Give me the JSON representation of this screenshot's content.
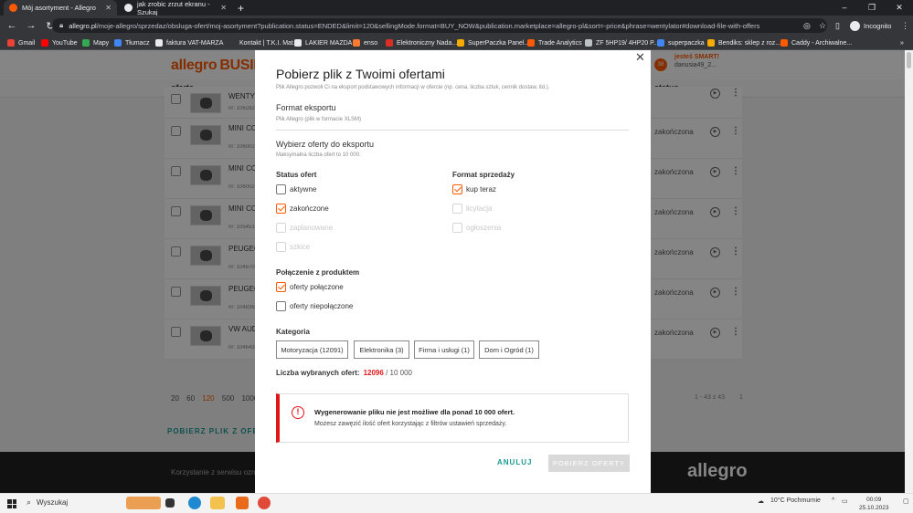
{
  "browser": {
    "tabs": [
      {
        "title": "Mój asortyment - Allegro",
        "active": true,
        "color": "#ff5a00"
      },
      {
        "title": "jak zrobic zrzut ekranu - Szukaj",
        "active": false,
        "color": "#4285f4"
      }
    ],
    "url_host": "allegro.pl",
    "url_path": "/moje-allegro/sprzedaz/obsluga-ofert/moj-asortyment?publication.status=ENDED&limit=120&sellingMode.format=BUY_NOW&publication.marketplace=allegro-pl&sort=-price&phrase=wentylator#download-file-with-offers",
    "incognito_label": "Incognito",
    "bookmarks": [
      {
        "label": "Gmail",
        "color": "#ea4335"
      },
      {
        "label": "YouTube",
        "color": "#ff0000"
      },
      {
        "label": "Mapy",
        "color": "#34a853"
      },
      {
        "label": "Tłumacz",
        "color": "#4285f4"
      },
      {
        "label": "faktura VAT-MARZA",
        "color": "#e8eaed"
      },
      {
        "label": "Kontakt | T.K.I. Mat...",
        "color": "#35363a"
      },
      {
        "label": "LAKIER MAZDA",
        "color": "#e8eaed"
      },
      {
        "label": "enso",
        "color": "#ff7a2f"
      },
      {
        "label": "Elektroniczny Nada...",
        "color": "#d93025"
      },
      {
        "label": "SuperPaczka Panel...",
        "color": "#f9ab00"
      },
      {
        "label": "Trade Analytics",
        "color": "#ff5a00"
      },
      {
        "label": "ZF 5HP19/ 4HP20 P...",
        "color": "#bdc1c6"
      },
      {
        "label": "superpaczka",
        "color": "#4285f4"
      },
      {
        "label": "Bendiks: sklep z roz...",
        "color": "#f9ab00"
      },
      {
        "label": "Caddy - Archiwalne...",
        "color": "#ff5a00"
      }
    ]
  },
  "page": {
    "logo": "allegro",
    "logo_suffix": "BUSIN",
    "account_line1": "jesteś SMART!",
    "account_line2": "danusia49_2...",
    "cart_count": "38",
    "col_oferta": "oferta",
    "col_status": "status",
    "rows": [
      {
        "title": "WENTYL",
        "nr": "nr: 106282",
        "status": ""
      },
      {
        "title": "MINI CO DMUCHA",
        "nr": "nr: 106002",
        "status": "zakończona"
      },
      {
        "title": "MINI CO DMUCHA",
        "nr": "nr: 106002",
        "status": "zakończona"
      },
      {
        "title": "MINI CO DMUCHA",
        "nr": "nr: 105451",
        "status": "zakończona"
      },
      {
        "title": "PEUGEO WENTYL",
        "nr": "nr: 104870",
        "status": "zakończona"
      },
      {
        "title": "PEUGEO WENTYL",
        "nr": "nr: 104836",
        "status": "zakończona"
      },
      {
        "title": "VW AUD WENTYL",
        "nr": "nr: 104643",
        "status": "zakończona"
      }
    ],
    "pager": [
      "20",
      "60",
      "120",
      "500",
      "1000"
    ],
    "pager_selected": "120",
    "pager_info": "1 - 43 z 43",
    "pager_page": "1",
    "download_link": "POBIERZ PLIK Z OFERT",
    "footer_text": "Korzystanie z serwisu ozna",
    "footer_logo": "allegro"
  },
  "modal": {
    "title": "Pobierz plik z Twoimi ofertami",
    "subtitle": "Plik Allegro pozwoli Ci na eksport podstawowych informacji w ofercie (np. cena, liczba sztuk, cennik dostaw, itd.).",
    "format_title": "Format eksportu",
    "format_sub": "Plik Allegro (plik w formacie XLSM)",
    "select_title": "Wybierz oferty do eksportu",
    "select_sub": "Maksymalna liczba ofert to 10 000.",
    "status_title": "Status ofert",
    "status_options": [
      {
        "label": "aktywne",
        "checked": false,
        "disabled": false
      },
      {
        "label": "zakończone",
        "checked": true,
        "disabled": false
      },
      {
        "label": "zaplanowane",
        "checked": false,
        "disabled": true
      },
      {
        "label": "szkice",
        "checked": false,
        "disabled": true
      }
    ],
    "format_sale_title": "Format sprzedaży",
    "format_sale_options": [
      {
        "label": "kup teraz",
        "checked": true,
        "disabled": false
      },
      {
        "label": "licytacja",
        "checked": false,
        "disabled": true
      },
      {
        "label": "ogłoszenia",
        "checked": false,
        "disabled": true
      }
    ],
    "link_title": "Połączenie z produktem",
    "link_options": [
      {
        "label": "oferty połączone",
        "checked": true,
        "disabled": false
      },
      {
        "label": "oferty niepołączone",
        "checked": false,
        "disabled": false
      }
    ],
    "category_title": "Kategoria",
    "categories": [
      "Motoryzacja (12091)",
      "Elektronika (3)",
      "Firma i usługi (1)",
      "Dom i Ogród (1)"
    ],
    "count_label": "Liczba wybranych ofert:",
    "count_value": "12096",
    "count_total": "/ 10 000",
    "alert_title": "Wygenerowanie pliku nie jest możliwe dla ponad 10 000 ofert.",
    "alert_desc": "Możesz zawęzić ilość ofert korzystając z filtrów ustawień sprzedaży.",
    "cancel_label": "ANULUJ",
    "download_label": "POBIERZ OFERTY"
  },
  "taskbar": {
    "search_label": "Wyszukaj",
    "weather": "10°C  Pochmurnie",
    "time": "00:09",
    "date": "25.10.2023"
  }
}
